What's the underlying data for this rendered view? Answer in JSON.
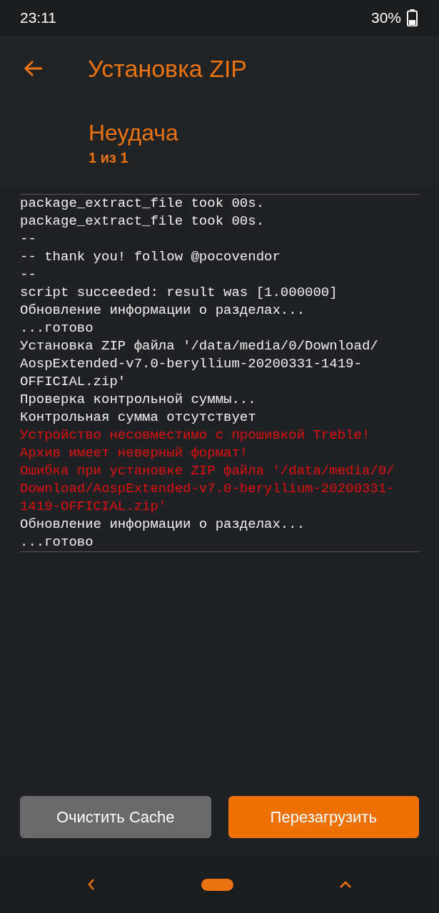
{
  "status_bar": {
    "time": "23:11",
    "battery": "30%"
  },
  "header": {
    "title": "Установка ZIP",
    "status": "Неудача",
    "progress": "1 из 1"
  },
  "log": [
    {
      "text": "package_extract_file took 00s.",
      "kind": "info"
    },
    {
      "text": "package_extract_file took 00s.",
      "kind": "info"
    },
    {
      "text": "--",
      "kind": "info"
    },
    {
      "text": "-- thank you! follow @pocovendor",
      "kind": "info"
    },
    {
      "text": "--",
      "kind": "info"
    },
    {
      "text": "script succeeded: result was [1.000000]",
      "kind": "info"
    },
    {
      "text": "Обновление информации о разделах...",
      "kind": "info"
    },
    {
      "text": "...готово",
      "kind": "info"
    },
    {
      "text": "Установка ZIP файла '/data/media/0/Download/",
      "kind": "info"
    },
    {
      "text": "AospExtended-v7.0-beryllium-20200331-1419-",
      "kind": "info"
    },
    {
      "text": "OFFICIAL.zip'",
      "kind": "info"
    },
    {
      "text": "Проверка контрольной суммы...",
      "kind": "info"
    },
    {
      "text": "Контрольная сумма отсутствует",
      "kind": "info"
    },
    {
      "text": "Устройство несовместимо с прошивкой Treble!",
      "kind": "error"
    },
    {
      "text": "Архив имеет неверный формат!",
      "kind": "error"
    },
    {
      "text": "Ошибка при установке ZIP файла '/data/media/0/",
      "kind": "error"
    },
    {
      "text": "Download/AospExtended-v7.0-beryllium-20200331-",
      "kind": "error"
    },
    {
      "text": "1419-OFFICIAL.zip'",
      "kind": "error"
    },
    {
      "text": "Обновление информации о разделах...",
      "kind": "info"
    },
    {
      "text": "...готово",
      "kind": "info"
    }
  ],
  "buttons": [
    {
      "label": "Очистить Cache",
      "kind": "secondary"
    },
    {
      "label": "Перезагрузить",
      "kind": "primary"
    }
  ]
}
